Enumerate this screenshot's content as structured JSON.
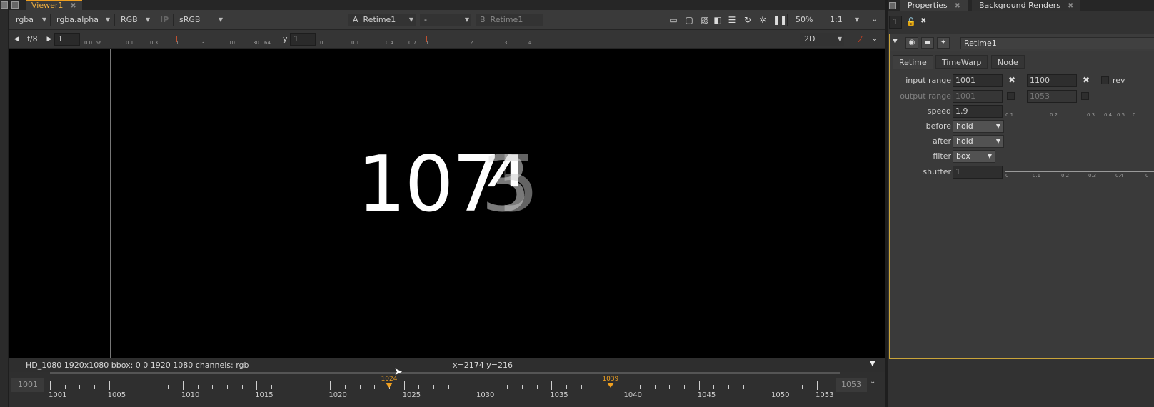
{
  "viewer": {
    "tab_label": "Viewer1",
    "toolbar1": {
      "channels": "rgba",
      "alpha_channel": "rgba.alpha",
      "display_mode": "RGB",
      "ip_label": "IP",
      "colorspace": "sRGB",
      "input_a_prefix": "A",
      "input_a": "Retime1",
      "input_op": "-",
      "input_b_prefix": "B",
      "input_b": "Retime1",
      "zoom": "50%",
      "proxy": "1:1"
    },
    "toolbar2": {
      "fstop": "f/8",
      "gain_value": "1",
      "gain_ticks": [
        "0.0156",
        "0.1",
        "0.3",
        "1",
        "3",
        "10",
        "30",
        "64"
      ],
      "gamma_label": "y",
      "gamma_value": "1",
      "gamma_ticks": [
        "0",
        "0.1",
        "0.4",
        "0.7",
        "1",
        "2",
        "3",
        "4"
      ],
      "view_mode": "2D"
    },
    "frame_text": "1074",
    "frame_main": "107",
    "frame_ghost": "3",
    "info_left": "HD_1080 1920x1080  bbox: 0 0 1920 1080 channels: rgb",
    "info_coords": "x=2174 y=216",
    "timeline": {
      "start": "1001",
      "end": "1053",
      "ticks": [
        "1001",
        "1005",
        "1010",
        "1015",
        "1020",
        "1025",
        "1030",
        "1035",
        "1040",
        "1045",
        "1050",
        "1053"
      ],
      "key_in": "1024",
      "key_out": "1039"
    }
  },
  "properties": {
    "tabs": [
      "Properties",
      "Background Renders"
    ],
    "max_panels": "1",
    "node_name": "Retime1",
    "node_tabs": [
      "Retime",
      "TimeWarp",
      "Node"
    ],
    "knobs": {
      "input_range_label": "input range",
      "input_first": "1001",
      "input_last": "1100",
      "reverse_label": "rev",
      "output_range_label": "output range",
      "output_first": "1001",
      "output_last": "1053",
      "speed_label": "speed",
      "speed_value": "1.9",
      "speed_ticks": [
        "0.1",
        "0.2",
        "0.3",
        "0.4",
        "0.5",
        "0"
      ],
      "before_label": "before",
      "before_value": "hold",
      "after_label": "after",
      "after_value": "hold",
      "filter_label": "filter",
      "filter_value": "box",
      "shutter_label": "shutter",
      "shutter_value": "1",
      "shutter_ticks": [
        "0",
        "0.1",
        "0.2",
        "0.3",
        "0.4",
        "0"
      ]
    }
  }
}
